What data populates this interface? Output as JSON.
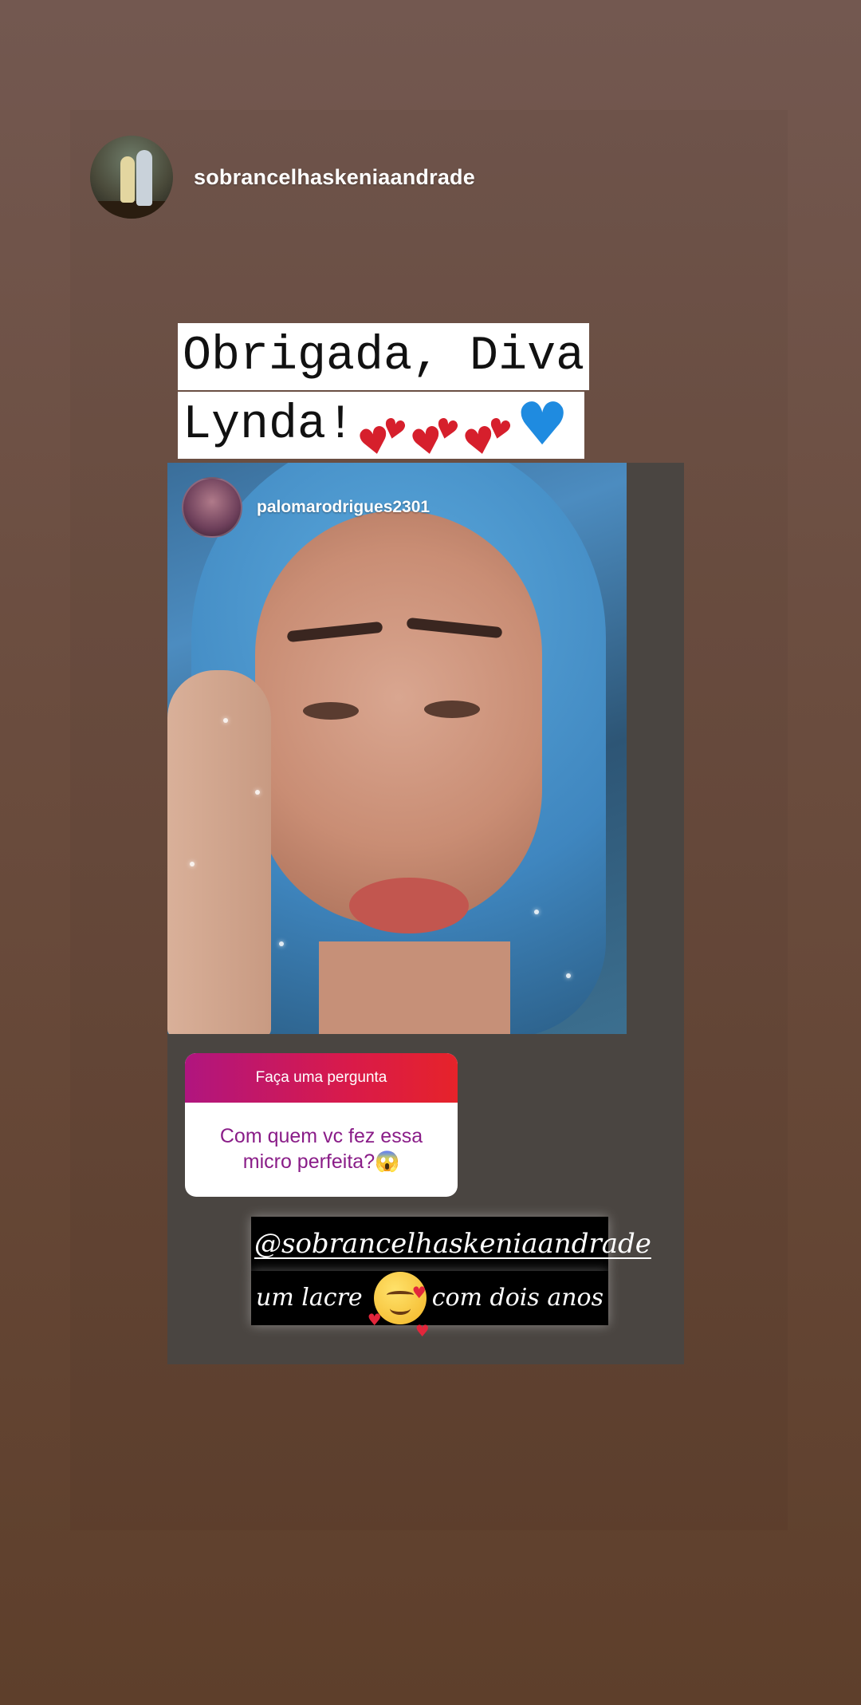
{
  "story": {
    "author": {
      "username": "sobrancelhaskeniaandrade",
      "avatar_icon": "profile-avatar"
    },
    "caption": {
      "line1": "Obrigada, Diva",
      "line2_text": "Lynda!",
      "emojis": [
        "two-hearts-icon",
        "two-hearts-icon",
        "two-hearts-icon",
        "blue-heart-icon"
      ],
      "colors": {
        "hearts": "#d61f2c",
        "blue_heart": "#1f8be0"
      }
    },
    "shared_post": {
      "username": "palomarodrigues2301",
      "question_sticker": {
        "header": "Faça uma pergunta",
        "question": "Com quem vc fez essa micro perfeita?😱",
        "header_gradient": [
          "#b0157f",
          "#e6232a"
        ],
        "text_color": "#8a1d88"
      },
      "answer": {
        "line1": "@sobrancelhaskeniaandrade",
        "line2_a": "um lacre",
        "line2_b": "com dois anos",
        "emoji_icon": "smiling-face-with-hearts-icon"
      }
    }
  }
}
